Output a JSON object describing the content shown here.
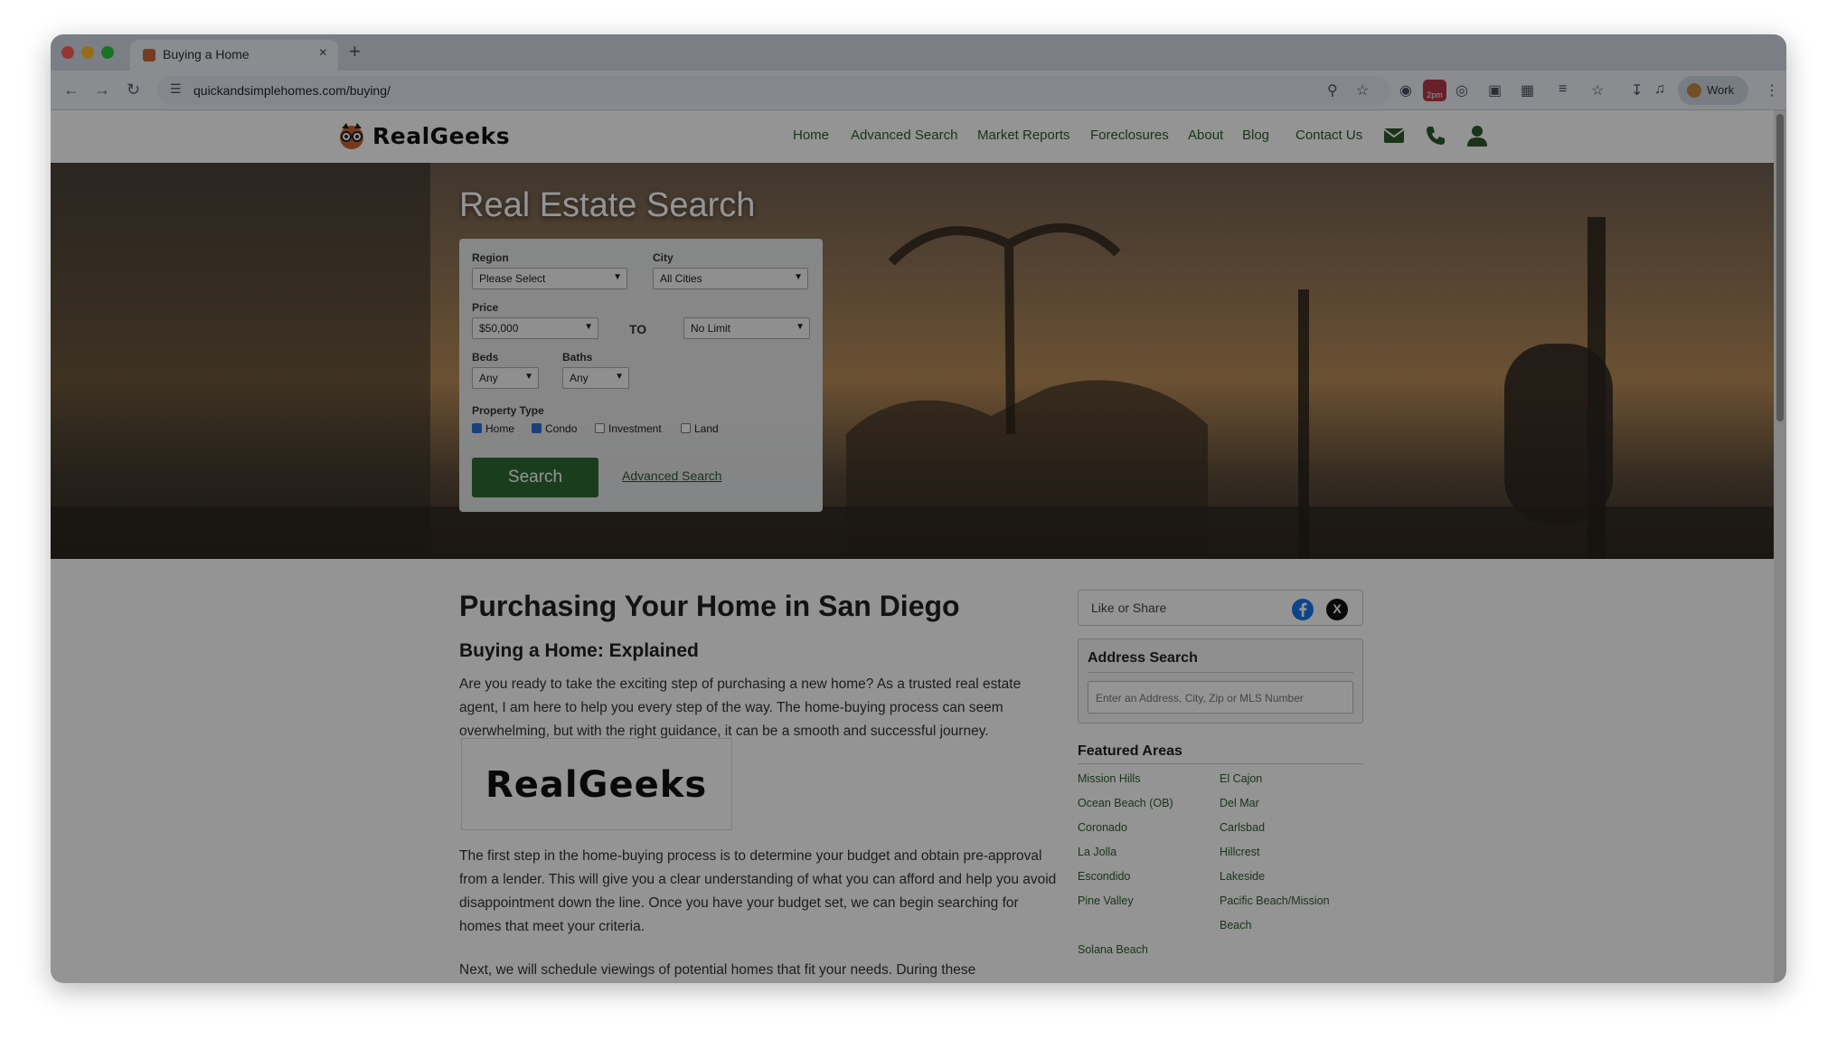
{
  "browser": {
    "tab_title": "Buying a Home",
    "tab_close": "×",
    "new_tab": "+",
    "url": "quickandsimplehomes.com/buying/",
    "ext_badge": "2pm",
    "profile_label": "Work"
  },
  "site": {
    "logo_text": "RealGeeks",
    "nav": [
      "Home",
      "Advanced Search",
      "Market Reports",
      "Foreclosures",
      "About",
      "Blog",
      "Contact Us"
    ]
  },
  "hero": {
    "title": "Real Estate Search",
    "region_label": "Region",
    "region_value": "Please Select",
    "city_label": "City",
    "city_value": "All Cities",
    "price_label": "Price",
    "price_min": "$50,000",
    "to_label": "TO",
    "price_max": "No Limit",
    "beds_label": "Beds",
    "beds_value": "Any",
    "baths_label": "Baths",
    "baths_value": "Any",
    "property_type_label": "Property Type",
    "types": [
      {
        "label": "Home",
        "checked": true
      },
      {
        "label": "Condo",
        "checked": true
      },
      {
        "label": "Investment",
        "checked": false
      },
      {
        "label": "Land",
        "checked": false
      }
    ],
    "search_button": "Search",
    "advanced_link": "Advanced Search"
  },
  "article": {
    "title": "Purchasing Your Home in San Diego",
    "subtitle": "Buying a Home: Explained",
    "para1": "Are you ready to take the exciting step of purchasing a new home? As a trusted real estate agent, I am here to help you every step of the way. The home-buying process can seem overwhelming, but with the right guidance, it can be a smooth and successful journey.",
    "brand_image_text": "RealGeeks",
    "para2": "The first step in the home-buying process is to determine your budget and obtain pre-approval from a lender. This will give you a clear understanding of what you can afford and help you avoid disappointment down the line. Once you have your budget set, we can begin searching for homes that meet your criteria.",
    "para3": "Next, we will schedule viewings of potential homes that fit your needs. During these"
  },
  "sidebar": {
    "share_label": "Like or Share",
    "x_glyph": "X",
    "address_title": "Address Search",
    "address_placeholder": "Enter an Address, City, Zip or MLS Number",
    "featured_title": "Featured Areas",
    "areas_left": [
      "Mission Hills",
      "Ocean Beach (OB)",
      "Coronado",
      "La Jolla",
      "Escondido",
      "Pine Valley",
      "",
      "Solana Beach"
    ],
    "areas_right": [
      "El Cajon",
      "Del Mar",
      "Carlsbad",
      "Hillcrest",
      "Lakeside",
      "Pacific Beach/Mission",
      "Beach"
    ]
  },
  "colors": {
    "nav_green": "#2e5a2e",
    "button_green": "#2d6a35",
    "facebook_blue": "#1877f2"
  }
}
